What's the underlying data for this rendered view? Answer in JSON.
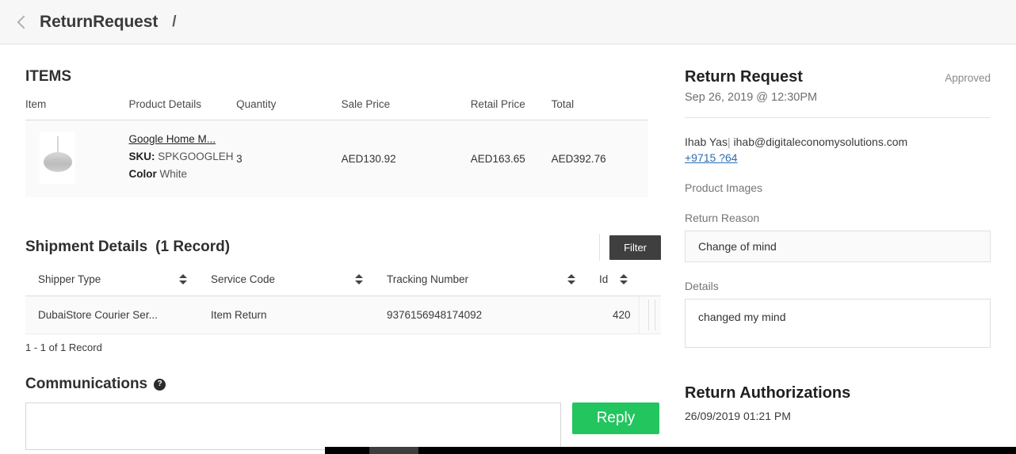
{
  "topbar": {
    "back_icon": "chevron-left-icon",
    "title": "ReturnRequest",
    "separator": "/"
  },
  "items_section": {
    "title": "ITEMS",
    "columns": [
      "Item",
      "Product Details",
      "Quantity",
      "Sale Price",
      "Retail Price",
      "Total"
    ],
    "rows": [
      {
        "thumbnail_icon": "google-home-mini-thumbnail",
        "product_name": "Google Home M...",
        "sku_label": "SKU:",
        "sku_value": "SPKGOOGLEH",
        "color_label": "Color",
        "color_value": "White",
        "quantity": "3",
        "sale_price": "AED130.92",
        "retail_price": "AED163.65",
        "total": "AED392.76"
      }
    ]
  },
  "shipment_section": {
    "title": "Shipment Details",
    "record_label": "(1 Record)",
    "filter_button": "Filter",
    "columns": [
      "Shipper Type",
      "Service Code",
      "Tracking Number",
      "Id"
    ],
    "rows": [
      {
        "shipper_type": "DubaiStore Courier Ser...",
        "service_code": "Item Return",
        "tracking_number": "9376156948174092",
        "id": "420"
      }
    ],
    "pagination": "1 - 1 of 1 Record"
  },
  "communications": {
    "title": "Communications",
    "help_icon": "question-mark-icon",
    "input_value": "",
    "input_placeholder": "",
    "reply_button": "Reply"
  },
  "return_request": {
    "title": "Return Request",
    "status": "Approved",
    "date": "Sep 26, 2019 @ 12:30PM",
    "contact_name": "Ihab Yas",
    "contact_separator": "|",
    "contact_email": "ihab@digitaleconomysolutions.com",
    "contact_phone": "+9715 ?64",
    "product_images_label": "Product Images",
    "return_reason_label": "Return Reason",
    "return_reason_value": "Change of mind",
    "details_label": "Details",
    "details_value": "changed my mind"
  },
  "return_authorizations": {
    "title": "Return Authorizations",
    "date": "26/09/2019 01:21 PM"
  },
  "colors": {
    "reply_green": "#22c55e",
    "filter_dark": "#3f3f3f",
    "link_blue": "#2b6cb0",
    "topbar_bg": "#f7f7f7"
  }
}
